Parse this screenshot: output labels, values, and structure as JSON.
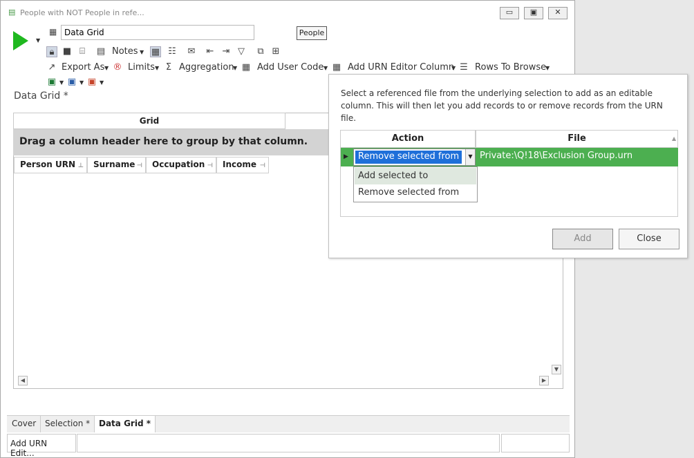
{
  "window": {
    "title": "People with NOT People in refe...",
    "min_glyph": "▭",
    "max_glyph": "▣",
    "close_glyph": "✕"
  },
  "header": {
    "name_value": "Data Grid",
    "table_button": "People"
  },
  "toolbar": {
    "notes": "Notes",
    "export_as": "Export As",
    "limits": "Limits",
    "aggregation": "Aggregation",
    "add_user_code": "Add User Code",
    "add_urn_editor": "Add URN Editor Column",
    "rows_to_browse": "Rows To Browse"
  },
  "main": {
    "doc_title": "Data Grid *",
    "grid_tab": "Grid",
    "group_hint": "Drag a column header here to group by that column.",
    "columns": [
      "Person URN",
      "Surname",
      "Occupation",
      "Income"
    ]
  },
  "bottom_tabs": [
    "Cover",
    "Selection *",
    "Data Grid *"
  ],
  "status": {
    "left": "Add URN Edit..."
  },
  "popup": {
    "description": "Select a referenced file from the underlying selection to add as an editable column.  This will then let you add records to or remove records from the URN file.",
    "col_action": "Action",
    "col_file": "File",
    "row_action": "Remove selected from",
    "row_file": "Private:\\Q!18\\Exclusion Group.urn",
    "options": [
      "Add selected to",
      "Remove selected from"
    ],
    "add_button": "Add",
    "close_button": "Close"
  },
  "icons": {
    "accent_green": "#1fb81f",
    "row_green": "#4caf50",
    "selection_blue": "#1e6fd9"
  }
}
